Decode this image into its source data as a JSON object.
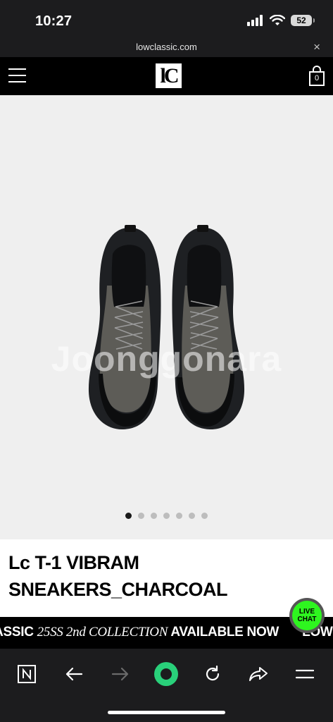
{
  "status_bar": {
    "time": "10:27",
    "battery": "52"
  },
  "url_bar": {
    "domain": "lowclassic.com",
    "close_symbol": "×"
  },
  "header": {
    "logo": "lC",
    "cart_count": "0"
  },
  "product": {
    "image_watermark": "Joonggonara",
    "gallery_total": 7,
    "gallery_active_index": 0,
    "title_line1": "Lc T-1 VIBRAM",
    "title_line2": "SNEAKERS_CHARCOAL"
  },
  "live_chat": {
    "line1": "LIVE",
    "line2": "CHAT"
  },
  "ticker": {
    "item1_a": "LOW CLASSIC ",
    "item1_b": "25SS 2nd COLLECTION",
    "item1_c": " AVAILABLE NOW",
    "item2": "LOW CLASSIC"
  },
  "colors": {
    "ticker_bg": "#000000",
    "live_chat_green": "#2ef51f",
    "browser_accent": "#29d07a"
  }
}
